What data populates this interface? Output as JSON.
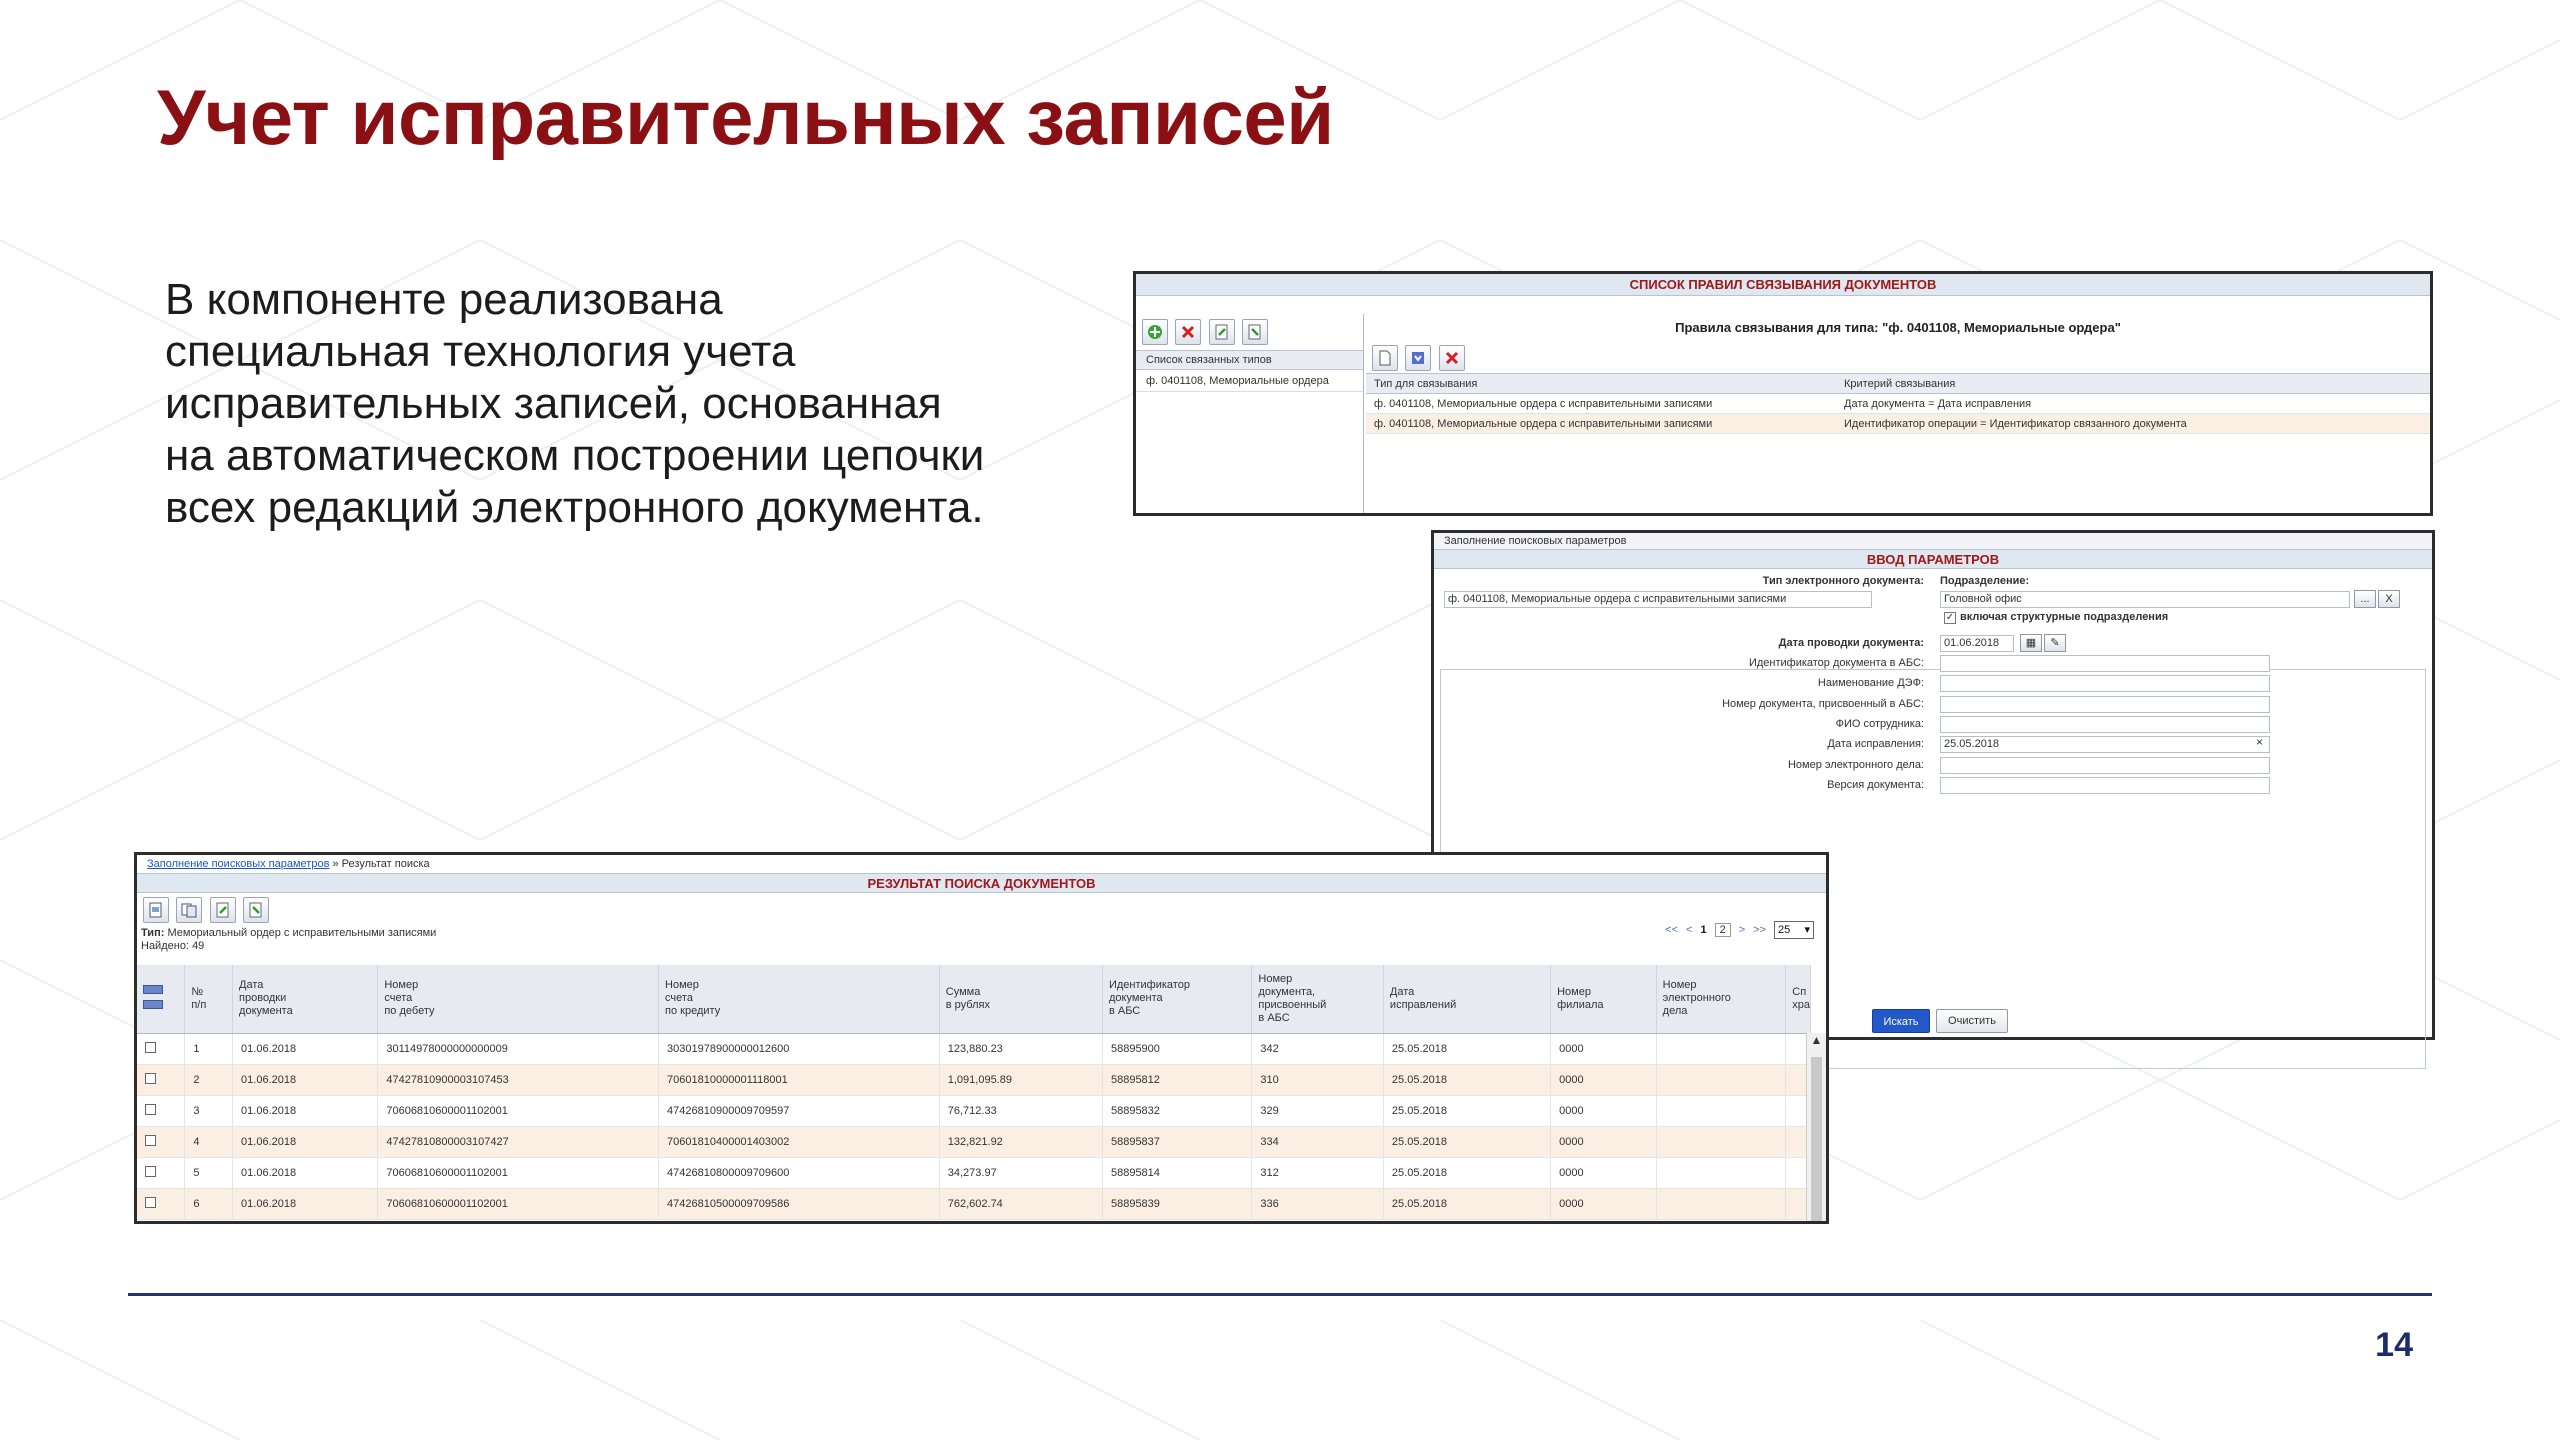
{
  "slide": {
    "title": "Учет исправительных записей",
    "body_lines": [
      "В компоненте реализована",
      "специальная технология учета",
      "исправительных записей, основанная",
      "на автоматическом построении цепочки",
      "всех редакций электронного документа."
    ],
    "page_number": "14"
  },
  "rules_screen": {
    "header": "СПИСОК ПРАВИЛ СВЯЗЫВАНИЯ ДОКУМЕНТОВ",
    "left_column_header": "Список связанных типов",
    "left_items": [
      "ф. 0401108, Мемориальные ордера"
    ],
    "right_title": "Правила связывания для типа: \"ф. 0401108, Мемориальные ордера\"",
    "table_headers": [
      "Тип для связывания",
      "Критерий связывания"
    ],
    "rows": [
      [
        "ф. 0401108, Мемориальные ордера с исправительными записями",
        "Дата документа = Дата исправления"
      ],
      [
        "ф. 0401108, Мемориальные ордера с исправительными записями",
        "Идентификатор операции = Идентификатор связанного документа"
      ]
    ]
  },
  "params_screen": {
    "caption": "Заполнение поисковых параметров",
    "header": "ВВОД ПАРАМЕТРОВ",
    "doc_type_label": "Тип электронного документа:",
    "doc_type_value": "ф. 0401108, Мемориальные ордера с исправительными записями",
    "division_label": "Подразделение:",
    "division_value": "Головной офис",
    "division_btn_more": "...",
    "division_btn_clear": "X",
    "include_sub_label": "включая структурные подразделения",
    "posting_date_label": "Дата проводки документа:",
    "posting_date_value": "01.06.2018",
    "fields": [
      {
        "label": "Идентификатор документа в АБС:",
        "value": ""
      },
      {
        "label": "Наименование ДЭФ:",
        "value": ""
      },
      {
        "label": "Номер документа, присвоенный в АБС:",
        "value": ""
      },
      {
        "label": "ФИО сотрудника:",
        "value": ""
      },
      {
        "label": "Дата исправления:",
        "value": "25.05.2018"
      },
      {
        "label": "Номер электронного дела:",
        "value": ""
      },
      {
        "label": "Версия документа:",
        "value": ""
      }
    ],
    "clear_x": "×",
    "search_button": "Искать",
    "clear_button": "Очистить"
  },
  "results_screen": {
    "breadcrumb_link": "Заполнение поисковых параметров",
    "breadcrumb_sep": "»",
    "breadcrumb_current": "Результат поиска",
    "header": "РЕЗУЛЬТАТ ПОИСКА ДОКУМЕНТОВ",
    "type_label": "Тип:",
    "type_value": "Мемориальный ордер с исправительными записями",
    "found_label": "Найдено:",
    "found_value": "49",
    "pager": {
      "first": "<<",
      "prev": "<",
      "page1": "1",
      "page2": "2",
      "next": ">",
      "last": ">>",
      "page_size": "25"
    },
    "columns": [
      "№\nп/п",
      "Дата\nпроводки\nдокумента",
      "Номер\nсчета\nпо дебету",
      "Номер\nсчета\nпо кредиту",
      "Сумма\nв рублях",
      "Идентификатор\nдокумента\nв АБС",
      "Номер\nдокумента,\nприсвоенный\nв АБС",
      "Дата\nисправлений",
      "Номер\nфилиала",
      "Номер\nэлектронного\nдела",
      "Сп\nхра"
    ],
    "rows": [
      [
        "1",
        "01.06.2018",
        "30114978000000000009",
        "30301978900000012600",
        "123,880.23",
        "58895900",
        "342",
        "25.05.2018",
        "0000",
        ""
      ],
      [
        "2",
        "01.06.2018",
        "47427810900003107453",
        "70601810000001118001",
        "1,091,095.89",
        "58895812",
        "310",
        "25.05.2018",
        "0000",
        ""
      ],
      [
        "3",
        "01.06.2018",
        "70606810600001102001",
        "47426810900009709597",
        "76,712.33",
        "58895832",
        "329",
        "25.05.2018",
        "0000",
        ""
      ],
      [
        "4",
        "01.06.2018",
        "47427810800003107427",
        "70601810400001403002",
        "132,821.92",
        "58895837",
        "334",
        "25.05.2018",
        "0000",
        ""
      ],
      [
        "5",
        "01.06.2018",
        "70606810600001102001",
        "47426810800009709600",
        "34,273.97",
        "58895814",
        "312",
        "25.05.2018",
        "0000",
        ""
      ],
      [
        "6",
        "01.06.2018",
        "70606810600001102001",
        "47426810500009709586",
        "762,602.74",
        "58895839",
        "336",
        "25.05.2018",
        "0000",
        ""
      ]
    ]
  }
}
